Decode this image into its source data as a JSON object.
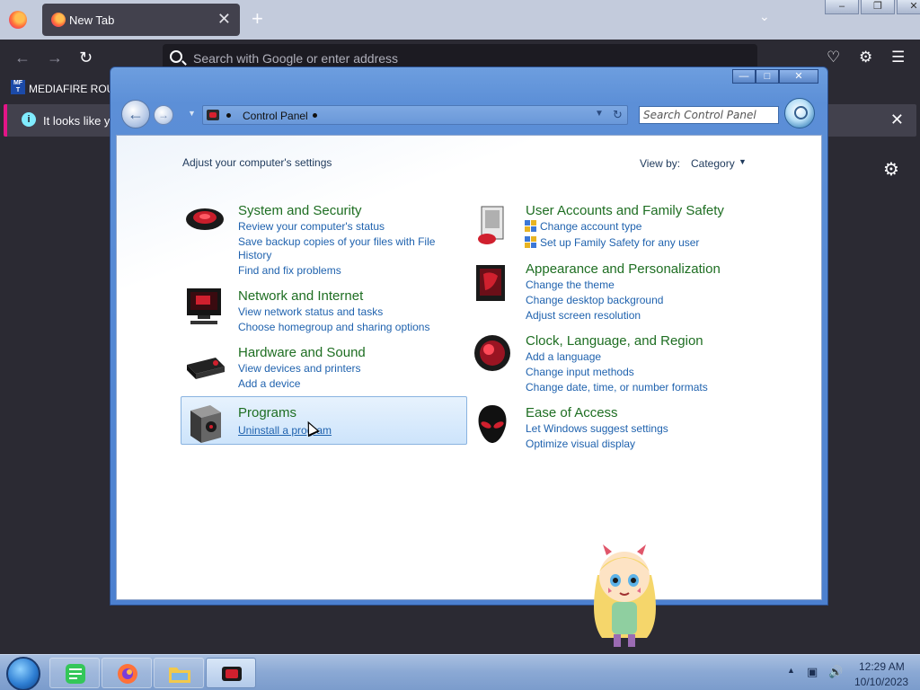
{
  "firefox": {
    "tab_title": "New Tab",
    "tab_close": "✕",
    "new_tab": "+",
    "url_placeholder": "Search with Google or enter address",
    "bookmark_icon_text": "MF T",
    "bookmark_label": "MEDIAFIRE ROUL",
    "notice_text": "It looks like you",
    "notice_close": "✕",
    "settings_icon": "⚙"
  },
  "control_panel": {
    "address_label": "Control Panel",
    "search_placeholder": "Search Control Panel",
    "heading": "Adjust your computer's settings",
    "view_by_label": "View by:",
    "view_by_value": "Category",
    "categories": [
      {
        "title": "System and Security",
        "links": [
          "Review your computer's status",
          "Save backup copies of your files with File",
          "History",
          "Find and fix problems"
        ]
      },
      {
        "title": "Network and Internet",
        "links": [
          "View network status and tasks",
          "Choose homegroup and sharing options"
        ]
      },
      {
        "title": "Hardware and Sound",
        "links": [
          "View devices and printers",
          "Add a device"
        ]
      },
      {
        "title": "Programs",
        "links": [
          "Uninstall a program"
        ]
      },
      {
        "title": "User Accounts and Family Safety",
        "links": [
          "Change account type",
          "Set up Family Safety for any user"
        ]
      },
      {
        "title": "Appearance and Personalization",
        "links": [
          "Change the theme",
          "Change desktop background",
          "Adjust screen resolution"
        ]
      },
      {
        "title": "Clock, Language, and Region",
        "links": [
          "Add a language",
          "Change input methods",
          "Change date, time, or number formats"
        ]
      },
      {
        "title": "Ease of Access",
        "links": [
          "Let Windows suggest settings",
          "Optimize visual display"
        ]
      }
    ]
  },
  "taskbar": {
    "time": "12:29 AM",
    "date": "10/10/2023"
  },
  "colors": {
    "category_title": "#1e6e22",
    "link": "#1f62ae",
    "window_frame": "#5c8fd7",
    "taskbar": "#8aa8d4"
  }
}
